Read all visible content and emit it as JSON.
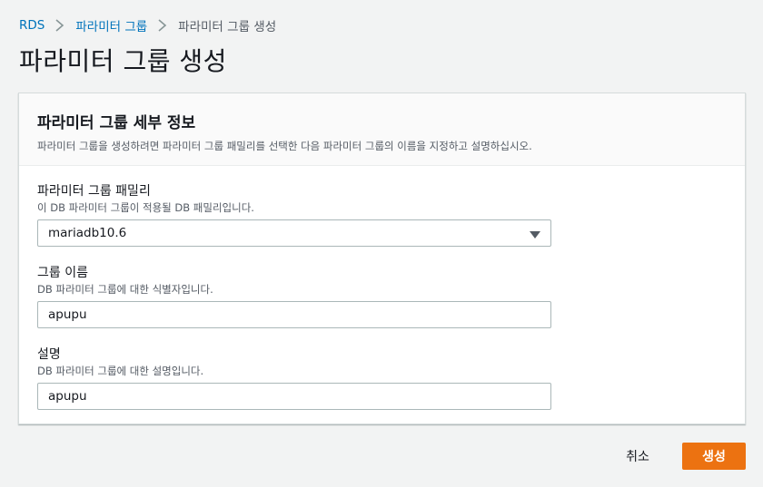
{
  "breadcrumb": {
    "items": [
      "RDS",
      "파라미터 그룹",
      "파라미터 그룹 생성"
    ],
    "separator_icon": "chevron-right-icon"
  },
  "page": {
    "title": "파라미터 그룹 생성"
  },
  "panel": {
    "title": "파라미터 그룹 세부 정보",
    "description": "파라미터 그룹을 생성하려면 파라미터 그룹 패밀리를 선택한 다음 파라미터 그룹의 이름을 지정하고 설명하십시오."
  },
  "fields": {
    "family": {
      "label": "파라미터 그룹 패밀리",
      "description": "이 DB 파라미터 그룹이 적용될 DB 패밀리입니다.",
      "value": "mariadb10.6",
      "icon": "caret-down-icon"
    },
    "name": {
      "label": "그룹 이름",
      "description": "DB 파라미터 그룹에 대한 식별자입니다.",
      "value": "apupu"
    },
    "description": {
      "label": "설명",
      "description": "DB 파라미터 그룹에 대한 설명입니다.",
      "value": "apupu"
    }
  },
  "actions": {
    "cancel_label": "취소",
    "create_label": "생성"
  },
  "colors": {
    "link": "#0073bb",
    "primary_button": "#ec7211",
    "background": "#f2f3f3"
  }
}
